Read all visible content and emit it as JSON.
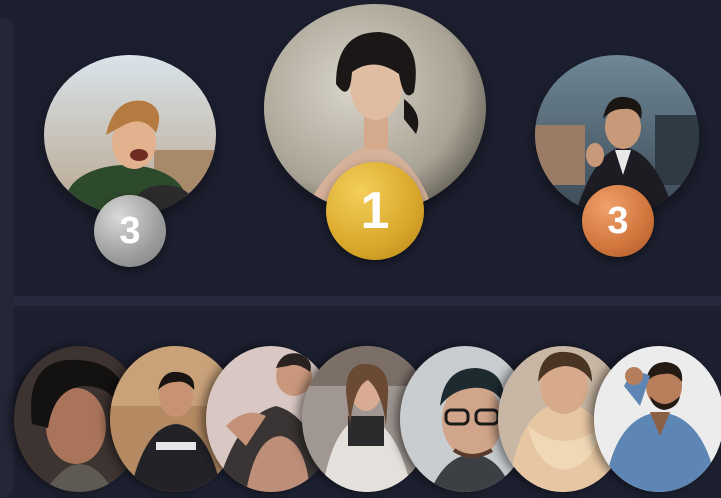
{
  "podium": [
    {
      "rank": "3",
      "person": "laughing-man-curly-hair",
      "badge_color": "#9c9c9c"
    },
    {
      "rank": "1",
      "person": "woman-short-black-hair",
      "badge_color": "#d9a72a"
    },
    {
      "rank": "3",
      "person": "man-in-suit",
      "badge_color": "#d0753c"
    }
  ],
  "others": [
    {
      "person": "curly-haired-young-man"
    },
    {
      "person": "man-in-jacket"
    },
    {
      "person": "tattooed-man-lying"
    },
    {
      "person": "woman-long-hair"
    },
    {
      "person": "man-with-glasses"
    },
    {
      "person": "woman-with-scarf"
    },
    {
      "person": "man-denim-shirt"
    }
  ],
  "colors": {
    "background": "#1d2030",
    "divider": "#262a3c",
    "gold": "#d9a72a",
    "silver": "#9c9c9c",
    "bronze": "#d0753c"
  }
}
